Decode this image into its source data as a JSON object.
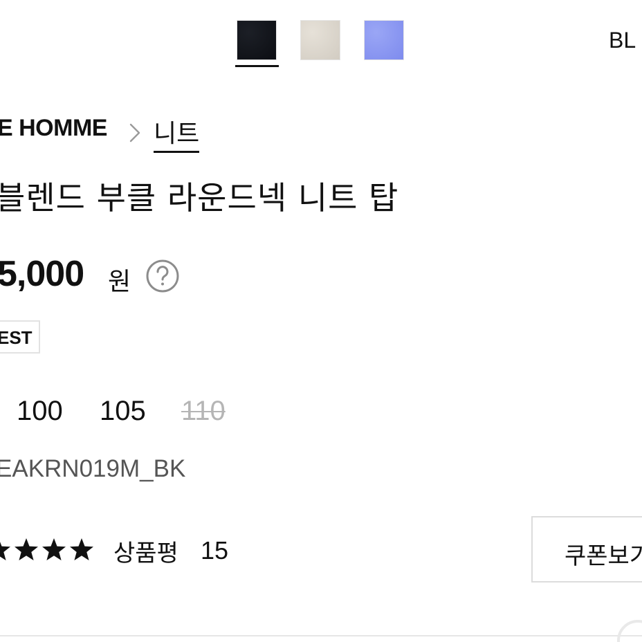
{
  "color_options": {
    "swatches": [
      {
        "name": "black-swatch",
        "color": "#14171d",
        "selected": true
      },
      {
        "name": "beige-swatch",
        "color": "#dcd7ce",
        "selected": false
      },
      {
        "name": "blue-swatch",
        "color": "#8c98f2",
        "selected": false
      }
    ],
    "selected_label": "BL"
  },
  "breadcrumb": {
    "brand": "E HOMME",
    "separator_icon": "chevron-right-icon",
    "category": "니트"
  },
  "product": {
    "title": "블렌드 부클 라운드넥 니트 탑",
    "price": "5,000",
    "price_unit": "원",
    "price_help_icon": "question-circle-icon",
    "badge": "EST",
    "sizes": [
      {
        "label": "100",
        "available": true
      },
      {
        "label": "105",
        "available": true
      },
      {
        "label": "110",
        "available": false
      }
    ],
    "code": "EAKRN019M_BK"
  },
  "reviews": {
    "stars_icon": "star-icon",
    "stars_visible": 4,
    "label": "상품평",
    "count": "15"
  },
  "coupon": {
    "button_label": "쿠폰보기"
  }
}
